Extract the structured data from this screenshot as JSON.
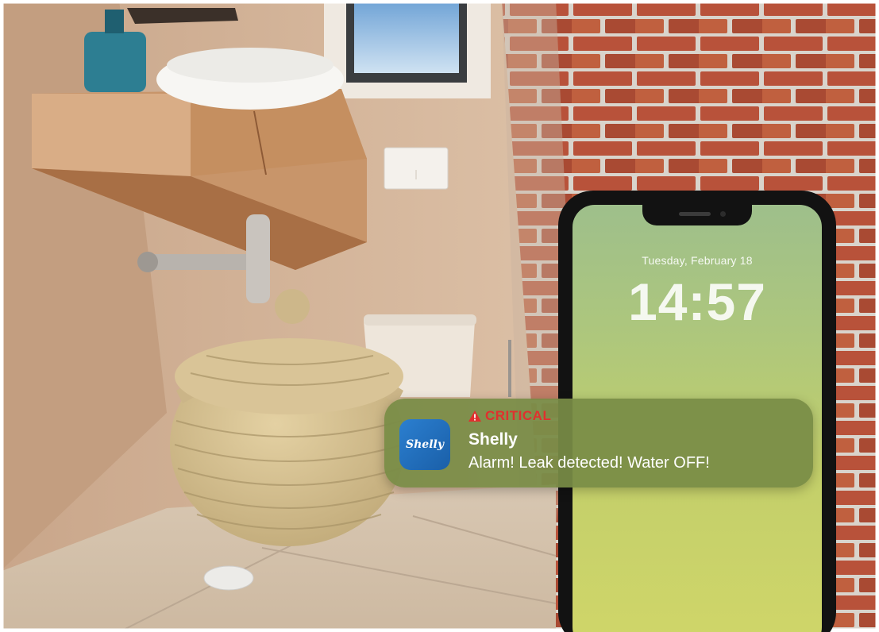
{
  "phone": {
    "lock_date": "Tuesday, February 18",
    "lock_time": "14:57"
  },
  "notification": {
    "level": "CRITICAL",
    "level_icon": "warning-triangle-icon",
    "level_color": "#e0302e",
    "app_icon": "shelly-app-icon",
    "app_icon_text": "Shelly",
    "app_name": "Shelly",
    "message": "Alarm! Leak detected! Water OFF!"
  }
}
